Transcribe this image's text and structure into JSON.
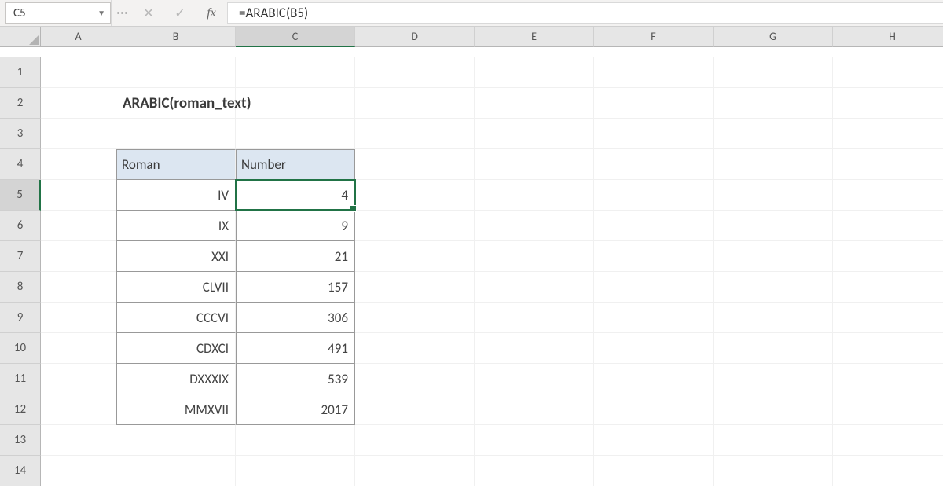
{
  "formula_bar": {
    "cell_ref": "C5",
    "fx_label": "fx",
    "formula": "=ARABIC(B5)"
  },
  "columns": [
    "A",
    "B",
    "C",
    "D",
    "E",
    "F",
    "G",
    "H"
  ],
  "rows": [
    "1",
    "2",
    "3",
    "4",
    "5",
    "6",
    "7",
    "8",
    "9",
    "10",
    "11",
    "12",
    "13",
    "14"
  ],
  "selected": {
    "col": "C",
    "row": "5"
  },
  "function_title": "ARABIC(roman_text)",
  "table": {
    "headers": {
      "roman": "Roman",
      "number": "Number"
    },
    "rows": [
      {
        "roman": "IV",
        "number": "4"
      },
      {
        "roman": "IX",
        "number": "9"
      },
      {
        "roman": "XXI",
        "number": "21"
      },
      {
        "roman": "CLVII",
        "number": "157"
      },
      {
        "roman": "CCCVI",
        "number": "306"
      },
      {
        "roman": "CDXCI",
        "number": "491"
      },
      {
        "roman": "DXXXIX",
        "number": "539"
      },
      {
        "roman": "MMXVII",
        "number": "2017"
      }
    ]
  }
}
